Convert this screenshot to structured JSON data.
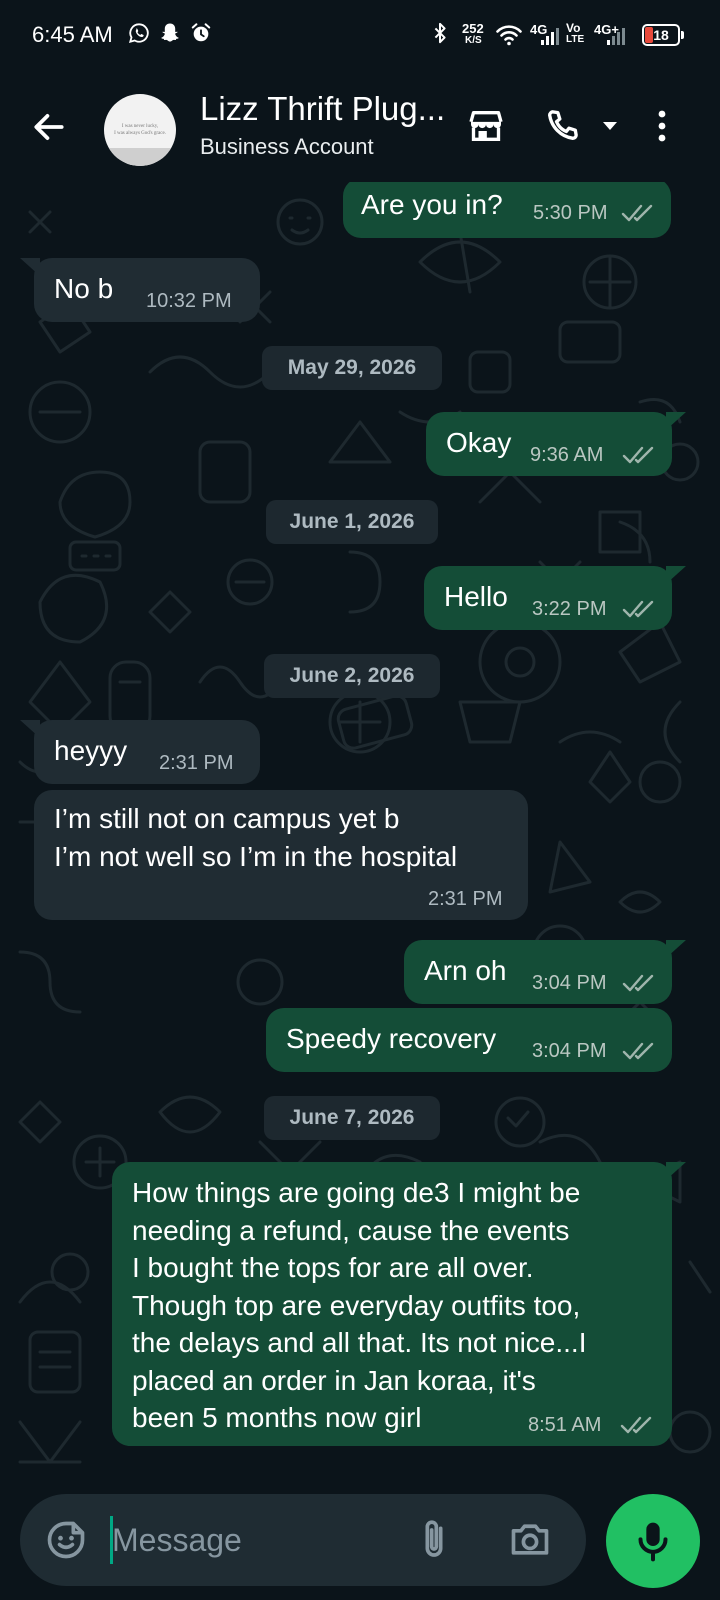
{
  "status_bar": {
    "time": "6:45 AM",
    "left_icons": [
      "whatsapp-icon",
      "snapchat-icon",
      "alarm-icon"
    ],
    "net_speed_value": "252",
    "net_speed_unit": "K/S",
    "network_1": "4G",
    "volte_top": "Vo",
    "volte_bottom": "LTE",
    "network_2": "4G+",
    "battery_level": "18",
    "right_icons": [
      "bluetooth-icon",
      "wifi-icon",
      "signal-icon",
      "battery-icon"
    ]
  },
  "header": {
    "contact_name": "Lizz Thrift Plug...",
    "subtitle": "Business Account",
    "avatar_lines": [
      "I was never lucky,",
      "I was always God's grace."
    ],
    "icons": [
      "back-arrow-icon",
      "store-icon",
      "phone-icon",
      "dropdown-icon",
      "more-vert-icon"
    ]
  },
  "messages": [
    {
      "direction": "out",
      "text": "Are you in?",
      "time": "5:30 PM",
      "status": "read"
    },
    {
      "direction": "in",
      "text": "No b",
      "time": "10:32 PM"
    },
    {
      "type": "date",
      "label": "May 29, 2026"
    },
    {
      "direction": "out",
      "text": "Okay",
      "time": "9:36 AM",
      "status": "read"
    },
    {
      "type": "date",
      "label": "June 1, 2026"
    },
    {
      "direction": "out",
      "text": "Hello",
      "time": "3:22 PM",
      "status": "read"
    },
    {
      "type": "date",
      "label": "June 2, 2026"
    },
    {
      "direction": "in",
      "text": "heyyy",
      "time": "2:31 PM"
    },
    {
      "direction": "in",
      "text": "I’m still not on campus yet b\nI’m not well so I’m in the hospital",
      "time": "2:31 PM"
    },
    {
      "direction": "out",
      "text": "Arn oh",
      "time": "3:04 PM",
      "status": "read"
    },
    {
      "direction": "out",
      "text": "Speedy recovery",
      "time": "3:04 PM",
      "status": "read"
    },
    {
      "type": "date",
      "label": "June 7, 2026"
    },
    {
      "direction": "out",
      "text": "How things are going de3 I might be\nneeding a refund, cause the events\nI bought the tops for are all over.\nThough top are everyday outfits too,\nthe delays and all that. Its not nice...I\nplaced an order in Jan koraa, it's\nbeen 5 months now girl",
      "time": "8:51 AM",
      "status": "read"
    }
  ],
  "composer": {
    "placeholder": "Message",
    "value": "",
    "icons": [
      "sticker-icon",
      "attach-icon",
      "camera-icon",
      "mic-icon"
    ]
  },
  "colors": {
    "background": "#0b141a",
    "outgoing_bubble": "#144d37",
    "incoming_bubble": "#202c33",
    "date_chip": "#1d282f",
    "read_ticks": "#9fb5ac",
    "accent_green": "#21c063"
  }
}
